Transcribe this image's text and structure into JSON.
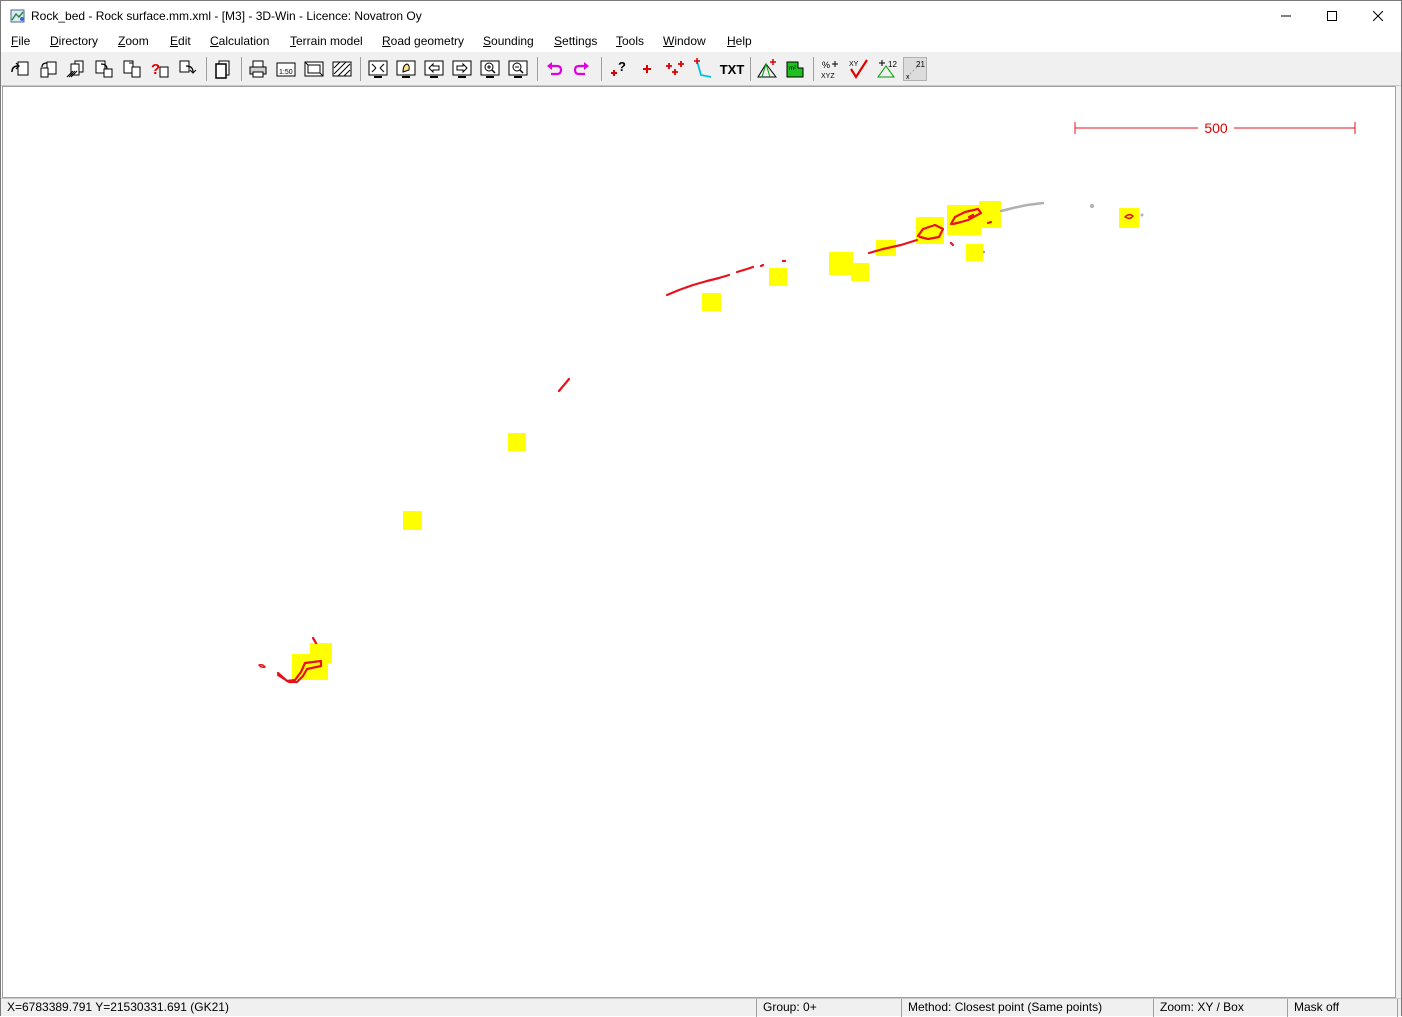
{
  "window": {
    "title": "Rock_bed - Rock surface.mm.xml - [M3] - 3D-Win - Licence: Novatron Oy"
  },
  "menu": [
    {
      "label": "File",
      "u": "F",
      "rest": "ile"
    },
    {
      "label": "Directory",
      "u": "D",
      "rest": "irectory"
    },
    {
      "label": "Zoom",
      "u": "Z",
      "rest": "oom"
    },
    {
      "label": "Edit",
      "u": "E",
      "rest": "dit"
    },
    {
      "label": "Calculation",
      "u": "C",
      "rest": "alculation"
    },
    {
      "label": "Terrain model",
      "u": "T",
      "rest": "errain model"
    },
    {
      "label": "Road geometry",
      "u": "R",
      "rest": "oad geometry"
    },
    {
      "label": "Sounding",
      "u": "S",
      "rest": "ounding"
    },
    {
      "label": "Settings",
      "u": "S",
      "rest": "ettings"
    },
    {
      "label": "Tools",
      "u": "T",
      "rest": "ools"
    },
    {
      "label": "Window",
      "u": "W",
      "rest": "indow"
    },
    {
      "label": "Help",
      "u": "H",
      "rest": "elp"
    }
  ],
  "toolbar": {
    "print_scale_label": "1:50",
    "txt_label": "TXT",
    "xyz_label": "XYZ",
    "n12_label": "12",
    "n21_label": "21"
  },
  "canvas": {
    "scale_bar_label": "500",
    "colors": {
      "line": "#e8101a",
      "highlight": "#ffff00",
      "gray_points": "#b0b0b0"
    }
  },
  "status": {
    "coords": "X=6783389.791  Y=21530331.691   (GK21)",
    "group": "Group: 0+",
    "method": "Method: Closest point (Same points)",
    "zoom": "Zoom: XY  /  Box",
    "mask": "Mask off"
  }
}
